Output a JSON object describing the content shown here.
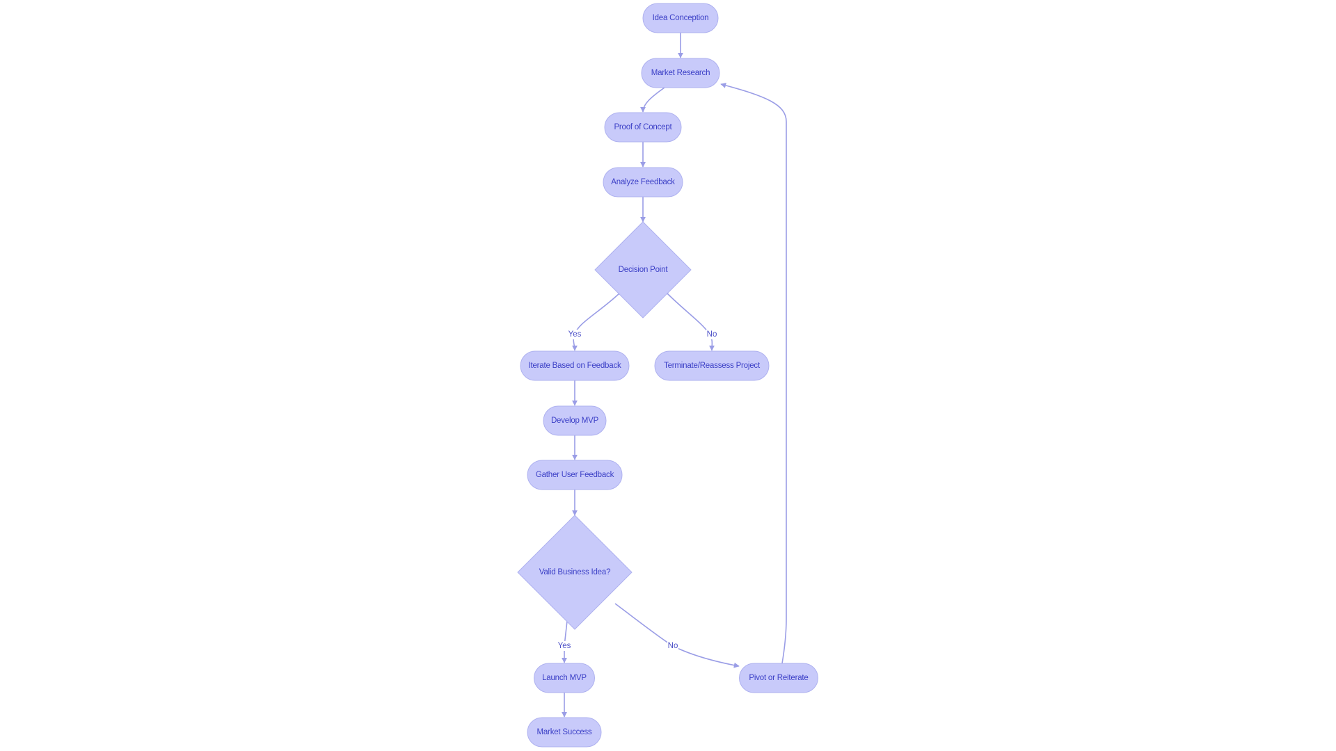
{
  "diagram": {
    "type": "flowchart",
    "direction": "top-down",
    "colors": {
      "node_fill": "#c8cafa",
      "node_stroke": "#aeb1ef",
      "node_text": "#3b3fc6",
      "edge": "#9a9de6",
      "edge_label_text": "#4e52c8"
    },
    "nodes": [
      {
        "id": "idea",
        "label": "Idea Conception",
        "shape": "stadium"
      },
      {
        "id": "research",
        "label": "Market Research",
        "shape": "stadium"
      },
      {
        "id": "poc",
        "label": "Proof of Concept",
        "shape": "stadium"
      },
      {
        "id": "analyze",
        "label": "Analyze Feedback",
        "shape": "stadium"
      },
      {
        "id": "decision",
        "label": "Decision Point",
        "shape": "diamond"
      },
      {
        "id": "iterate",
        "label": "Iterate Based on Feedback",
        "shape": "stadium"
      },
      {
        "id": "terminate",
        "label": "Terminate/Reassess Project",
        "shape": "stadium"
      },
      {
        "id": "mvp",
        "label": "Develop MVP",
        "shape": "stadium"
      },
      {
        "id": "gather",
        "label": "Gather User Feedback",
        "shape": "stadium"
      },
      {
        "id": "valid",
        "label": "Valid Business Idea?",
        "shape": "diamond"
      },
      {
        "id": "launch",
        "label": "Launch MVP",
        "shape": "stadium"
      },
      {
        "id": "pivot",
        "label": "Pivot or Reiterate",
        "shape": "stadium"
      },
      {
        "id": "success",
        "label": "Market Success",
        "shape": "stadium"
      }
    ],
    "edges": [
      {
        "from": "idea",
        "to": "research",
        "label": ""
      },
      {
        "from": "research",
        "to": "poc",
        "label": ""
      },
      {
        "from": "poc",
        "to": "analyze",
        "label": ""
      },
      {
        "from": "analyze",
        "to": "decision",
        "label": ""
      },
      {
        "from": "decision",
        "to": "iterate",
        "label": "Yes"
      },
      {
        "from": "decision",
        "to": "terminate",
        "label": "No"
      },
      {
        "from": "iterate",
        "to": "mvp",
        "label": ""
      },
      {
        "from": "mvp",
        "to": "gather",
        "label": ""
      },
      {
        "from": "gather",
        "to": "valid",
        "label": ""
      },
      {
        "from": "valid",
        "to": "launch",
        "label": "Yes"
      },
      {
        "from": "valid",
        "to": "pivot",
        "label": "No"
      },
      {
        "from": "launch",
        "to": "success",
        "label": ""
      },
      {
        "from": "pivot",
        "to": "research",
        "label": ""
      }
    ]
  }
}
